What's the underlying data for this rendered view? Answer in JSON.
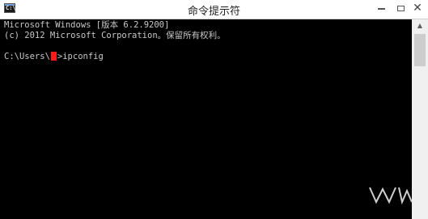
{
  "window": {
    "title": "命令提示符",
    "icon": "cmd-icon",
    "icon_glyph": "C:\\",
    "controls": {
      "minimize": "minimize-icon",
      "maximize": "maximize-icon",
      "close": "close-icon"
    }
  },
  "console": {
    "line1": "Microsoft Windows [版本 6.2.9200]",
    "line2": "(c) 2012 Microsoft Corporation。保留所有权利。",
    "prompt_prefix": "C:\\Users\\",
    "prompt_suffix": ">ipconfig"
  },
  "colors": {
    "console_bg": "#000000",
    "console_text": "#c8c8c8",
    "redaction": "#ff1a1a"
  }
}
